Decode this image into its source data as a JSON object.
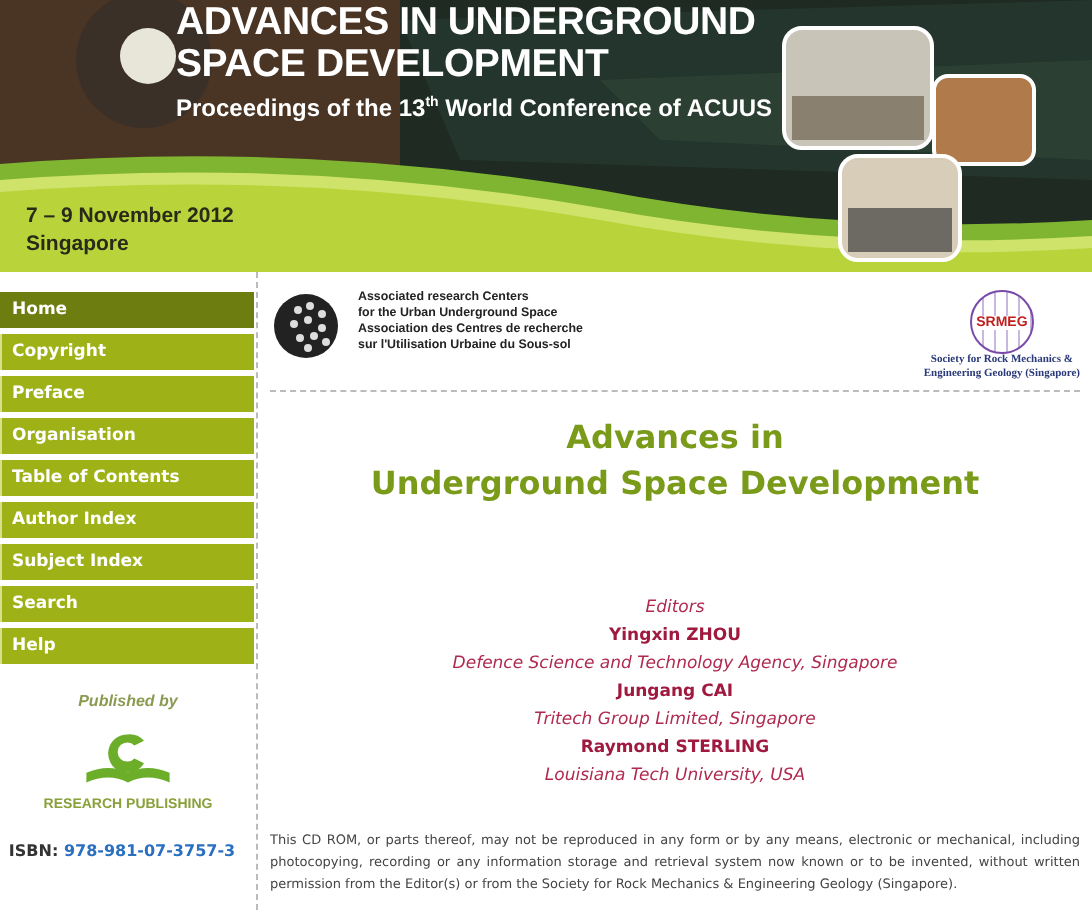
{
  "header": {
    "title_lines": [
      "ADVANCES IN UNDERGROUND",
      "SPACE DEVELOPMENT"
    ],
    "subtitle": "Proceedings of the 13$^{th}$ World Conference of ACUUS",
    "dates": [
      "7 – 9 November 2012",
      "Singapore"
    ]
  },
  "sidebar": {
    "items": [
      {
        "label": "Home",
        "selected": true
      },
      {
        "label": "Copyright",
        "selected": false
      },
      {
        "label": "Preface",
        "selected": false
      },
      {
        "label": "Organisation",
        "selected": false
      },
      {
        "label": "Table of Contents",
        "selected": false
      },
      {
        "label": "Author Index",
        "selected": false
      },
      {
        "label": "Subject Index",
        "selected": false
      },
      {
        "label": "Search",
        "selected": false
      },
      {
        "label": "Help",
        "selected": false
      }
    ],
    "published_by": "Published by",
    "publisher": "RESEARCH PUBLISHING",
    "isbn_label": "ISBN:",
    "isbn": "978-981-07-3757-3"
  },
  "logos": {
    "acuus_lines": [
      "Associated research Centers",
      "for the Urban Underground Space",
      "Association des Centres de recherche",
      "sur l'Utilisation Urbaine du Sous-sol"
    ],
    "srmeg_badge": "SRMEG",
    "srmeg_caption": [
      "Society for Rock Mechanics &",
      "Engineering Geology (Singapore)"
    ]
  },
  "title_lines": [
    "Advances in",
    "Underground Space Development"
  ],
  "editors": [
    {
      "kind": "heading",
      "text": "Editors"
    },
    {
      "kind": "name",
      "text": "Yingxin ZHOU"
    },
    {
      "kind": "affiliation",
      "text": "Defence Science and Technology Agency, Singapore"
    },
    {
      "kind": "name",
      "text": "Jungang CAI"
    },
    {
      "kind": "affiliation",
      "text": "Tritech Group Limited, Singapore"
    },
    {
      "kind": "name",
      "text": "Raymond STERLING"
    },
    {
      "kind": "affiliation",
      "text": "Louisiana Tech University, USA"
    }
  ],
  "notice": "This CD ROM, or parts thereof, may not be reproduced in any form or by any means, electronic or mechanical, including photocopying, recording or any information storage and retrieval system now known or to be invented, without written permission from the Editor(s) or from the Society for Rock Mechanics & Engineering Geology (Singapore)."
}
